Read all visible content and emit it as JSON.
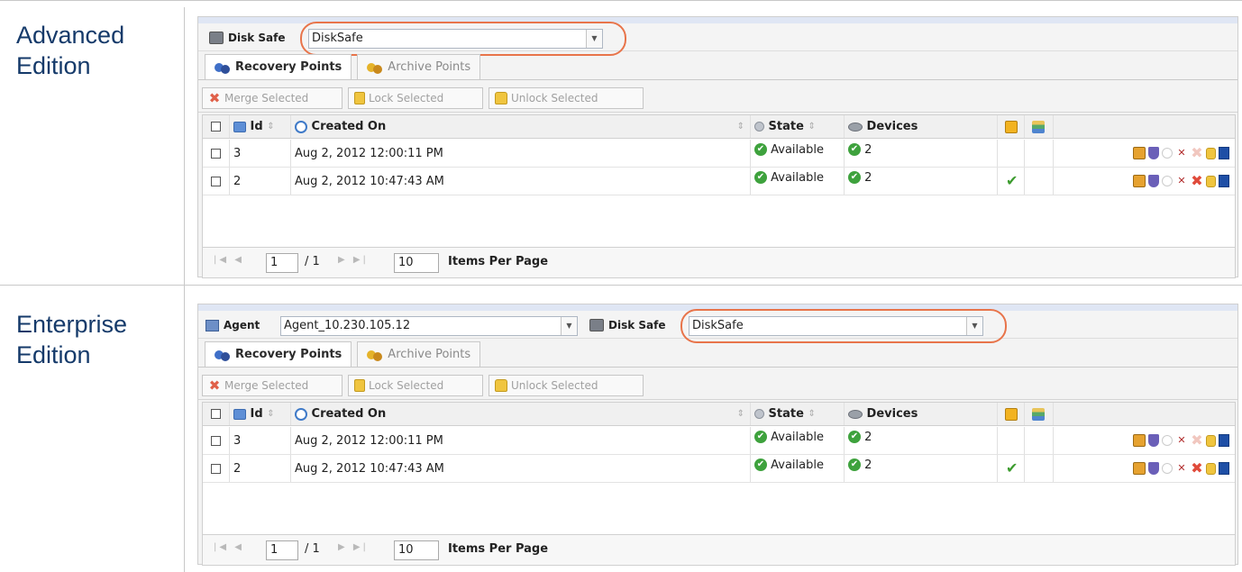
{
  "editions": [
    {
      "label": "Advanced Edition",
      "disk_safe_label": "Disk Safe",
      "disk_safe_value": "DiskSafe",
      "tabs": [
        "Recovery Points",
        "Archive Points"
      ],
      "toolbar": {
        "merge": "Merge Selected",
        "lock": "Lock Selected",
        "unlock": "Unlock Selected"
      },
      "columns": {
        "id": "Id",
        "created": "Created On",
        "state": "State",
        "devices": "Devices"
      },
      "rows": [
        {
          "id": "3",
          "created": "Aug 2, 2012 12:00:11 PM",
          "state": "Available",
          "devices": "2"
        },
        {
          "id": "2",
          "created": "Aug 2, 2012 10:47:43 AM",
          "state": "Available",
          "devices": "2"
        }
      ],
      "pager": {
        "page": "1",
        "of": "/ 1",
        "per_page": "10",
        "per_page_label": "Items Per Page"
      }
    },
    {
      "label": "Enterprise Edition",
      "agent_label": "Agent",
      "agent_value": "Agent_10.230.105.12",
      "disk_safe_label": "Disk Safe",
      "disk_safe_value": "DiskSafe",
      "tabs": [
        "Recovery Points",
        "Archive Points"
      ],
      "toolbar": {
        "merge": "Merge Selected",
        "lock": "Lock Selected",
        "unlock": "Unlock Selected"
      },
      "columns": {
        "id": "Id",
        "created": "Created On",
        "state": "State",
        "devices": "Devices"
      },
      "rows": [
        {
          "id": "3",
          "created": "Aug 2, 2012 12:00:11 PM",
          "state": "Available",
          "devices": "2"
        },
        {
          "id": "2",
          "created": "Aug 2, 2012 10:47:43 AM",
          "state": "Available",
          "devices": "2"
        }
      ],
      "pager": {
        "page": "1",
        "of": "/ 1",
        "per_page": "10",
        "per_page_label": "Items Per Page"
      }
    }
  ]
}
